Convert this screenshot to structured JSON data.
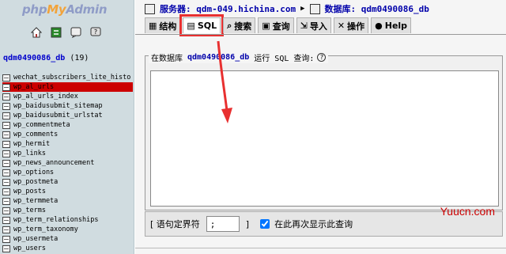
{
  "logo": {
    "php": "php",
    "my": "My",
    "admin": "Admin"
  },
  "left_icons": [
    "home-icon",
    "refresh-icon",
    "query-window-icon",
    "docs-icon"
  ],
  "sidebar": {
    "db_name": "qdm0490086_db",
    "table_count": "(19)",
    "tables": [
      "wechat_subscribers_lite_histo",
      "wp_al_urls",
      "wp_al_urls_index",
      "wp_baidusubmit_sitemap",
      "wp_baidusubmit_urlstat",
      "wp_commentmeta",
      "wp_comments",
      "wp_hermit",
      "wp_links",
      "wp_news_announcement",
      "wp_options",
      "wp_postmeta",
      "wp_posts",
      "wp_termmeta",
      "wp_terms",
      "wp_term_relationships",
      "wp_term_taxonomy",
      "wp_usermeta",
      "wp_users"
    ],
    "selected_index": 1
  },
  "breadcrumb": {
    "server_label": "服务器:",
    "server_value": "qdm-049.hichina.com",
    "db_label": "数据库:",
    "db_value": "qdm0490086_db"
  },
  "tabs": [
    {
      "label": "结构",
      "icon": "structure-icon"
    },
    {
      "label": "SQL",
      "icon": "sql-icon"
    },
    {
      "label": "搜索",
      "icon": "search-icon"
    },
    {
      "label": "查询",
      "icon": "query-icon"
    },
    {
      "label": "导入",
      "icon": "import-icon"
    },
    {
      "label": "操作",
      "icon": "operations-icon"
    },
    {
      "label": "Help",
      "icon": "help-icon"
    }
  ],
  "sql_form": {
    "legend_prefix": "在数据库",
    "legend_db": "qdm0490086_db",
    "legend_suffix": "运行 SQL 查询:",
    "help_glyph": "?",
    "query_text": ""
  },
  "bottom_bar": {
    "bracket_open": "[",
    "delimiter_label": "语句定界符",
    "delimiter_value": ";",
    "bracket_close": "]",
    "show_again_label": "在此再次显示此查询",
    "show_again_checked": true
  },
  "watermark": "Yuucn.com",
  "colors": {
    "highlight_red": "#e83030",
    "link_blue": "#0000aa",
    "selected_row": "#cc0000"
  }
}
